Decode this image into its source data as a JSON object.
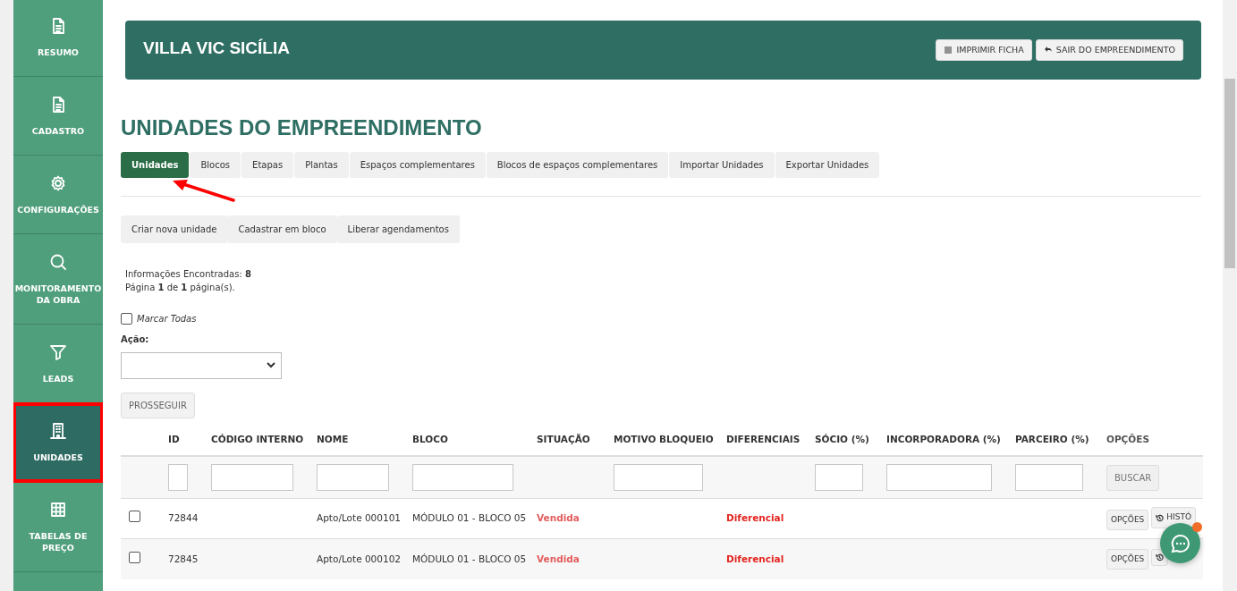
{
  "sidebar": {
    "items": [
      {
        "label": "RESUMO",
        "selected": false
      },
      {
        "label": "CADASTRO",
        "selected": false
      },
      {
        "label": "CONFIGURAÇÕES",
        "selected": false
      },
      {
        "label": "MONITORAMENTO DA OBRA",
        "selected": false
      },
      {
        "label": "LEADS",
        "selected": false
      },
      {
        "label": "UNIDADES",
        "selected": true,
        "highlighted": true
      },
      {
        "label": "TABELAS DE PREÇO",
        "selected": false
      }
    ]
  },
  "header": {
    "title": "VILLA VIC SICÍLIA",
    "buttons": [
      {
        "label": "IMPRIMIR FICHA"
      },
      {
        "label": "SAIR DO EMPREENDIMENTO"
      }
    ]
  },
  "page_title": "UNIDADES DO EMPREENDIMENTO",
  "tabs": [
    {
      "label": "Unidades",
      "selected": true,
      "pointed": true
    },
    {
      "label": "Blocos",
      "selected": false
    },
    {
      "label": "Etapas",
      "selected": false
    },
    {
      "label": "Plantas",
      "selected": false
    },
    {
      "label": "Espaços complementares",
      "selected": false
    },
    {
      "label": "Blocos de espaços complementares",
      "selected": false
    },
    {
      "label": "Importar Unidades",
      "selected": false
    },
    {
      "label": "Exportar Unidades",
      "selected": false
    }
  ],
  "actions": [
    "Criar nova unidade",
    "Cadastrar em bloco",
    "Liberar agendamentos"
  ],
  "info": [
    "Informações Encontradas: **8**",
    "Página **1** de **1** página(s)."
  ],
  "mark_all": {
    "label": "Marcar Todas",
    "checked": false
  },
  "action_label": "Ação:",
  "proceed_button": "PROSSEGUIR",
  "table": {
    "columns": [
      {
        "label": "ID",
        "filter": true
      },
      {
        "label": "CÓDIGO INTERNO",
        "filter": true
      },
      {
        "label": "NOME",
        "filter": true
      },
      {
        "label": "BLOCO",
        "filter": true
      },
      {
        "label": "SITUAÇÃO",
        "filter": false
      },
      {
        "label": "MOTIVO BLOQUEIO",
        "filter": true
      },
      {
        "label": "DIFERENCIAIS",
        "filter": false
      },
      {
        "label": "SÓCIO (%)",
        "filter": true
      },
      {
        "label": "INCORPORADORA (%)",
        "filter": true
      },
      {
        "label": "PARCEIRO (%)",
        "filter": true
      },
      {
        "label": "OPÇÕES",
        "filter": false
      }
    ],
    "search_button": "BUSCAR",
    "rows": [
      {
        "checked": false,
        "id": "72844",
        "name": "Apto/Lote 000101",
        "block": "MÓDULO 01 - BLOCO 05",
        "status": "Vendida",
        "extras": "Diferencial",
        "buttons": [
          {
            "kind": "text",
            "label": "OPÇÕES"
          },
          {
            "kind": "history",
            "label": "HISTÓ"
          }
        ]
      },
      {
        "checked": false,
        "id": "72845",
        "name": "Apto/Lote 000102",
        "block": "MÓDULO 01 - BLOCO 05",
        "status": "Vendida",
        "extras": "Diferencial",
        "buttons": [
          {
            "kind": "text",
            "label": "OPÇÕES"
          },
          {
            "kind": "history"
          }
        ]
      }
    ]
  },
  "chat": {
    "unread": true
  }
}
